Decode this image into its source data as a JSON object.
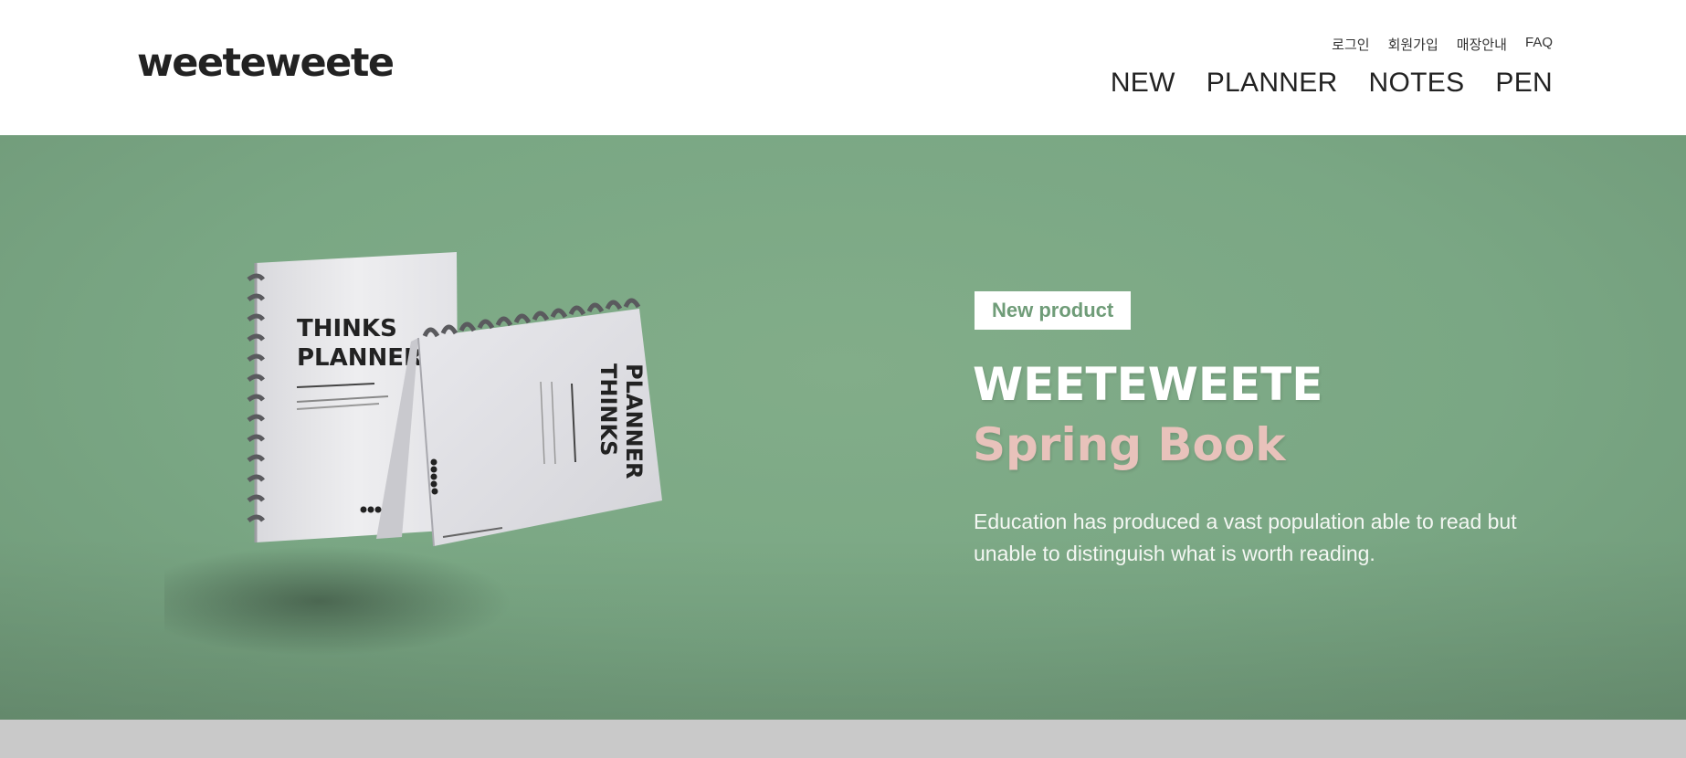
{
  "header": {
    "logo": "weeteweete",
    "util_nav": [
      "로그인",
      "회원가입",
      "매장안내",
      "FAQ"
    ],
    "main_nav": [
      "NEW",
      "PLANNER",
      "NOTES",
      "PEN"
    ]
  },
  "hero": {
    "badge": "New product",
    "title": "WEETEWEETE",
    "subtitle": "Spring Book",
    "description": "Education has produced a vast population able to read but unable to distinguish what is worth reading.",
    "image": {
      "notebook_title_line1": "THINKS",
      "notebook_title_line2": "PLANNER"
    }
  },
  "colors": {
    "hero_bg": "#7aa784",
    "badge_text": "#6f9c78",
    "subtitle_pink": "#e8c2bb",
    "bottom_strip": "#c9c9c9"
  }
}
